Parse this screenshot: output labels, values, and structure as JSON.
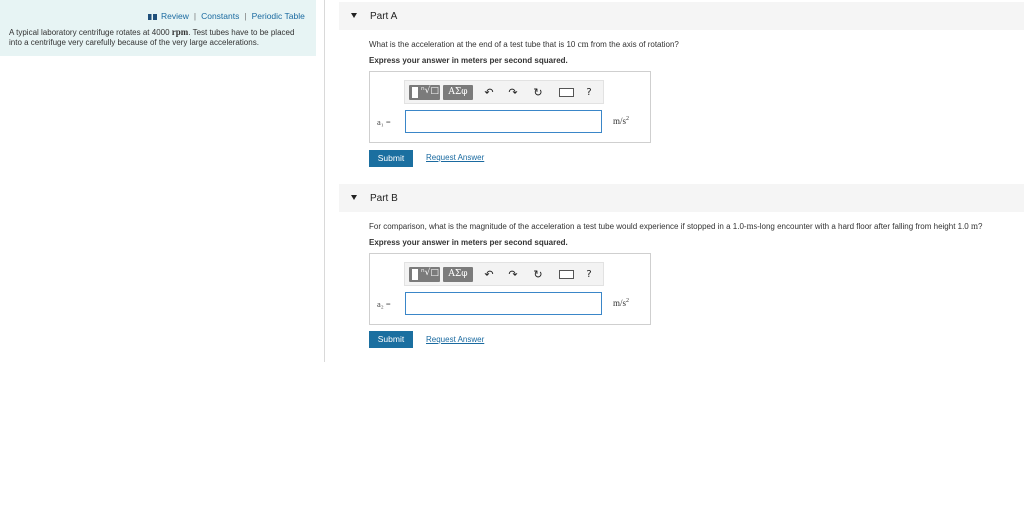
{
  "sidebar": {
    "links": {
      "review": "Review",
      "constants": "Constants",
      "periodic_table": "Periodic Table",
      "separator": "|"
    },
    "intro": {
      "text1": "A typical laboratory centrifuge rotates at 4000 ",
      "unit": "rpm",
      "text2": ". Test tubes have to be placed into a centrifuge very carefully because of the very large accelerations."
    }
  },
  "parts": [
    {
      "title": "Part A",
      "question": {
        "text1": "What is the acceleration at the end of a test tube that is 10 ",
        "unit": "cm",
        "text2": " from the axis of rotation?"
      },
      "instruction": "Express your answer in meters per second squared.",
      "variable_label": "a₁ =",
      "input_value": "",
      "unit_base": "m/s",
      "unit_exp": "2",
      "submit_label": "Submit",
      "request_label": "Request Answer"
    },
    {
      "title": "Part B",
      "question": {
        "text1": "For comparison, what is the magnitude of the acceleration a test tube would experience if stopped in a 1.0-",
        "unit1": "ms",
        "text2": "-long encounter with a hard floor after falling from height 1.0 ",
        "unit2": "m",
        "text3": "?"
      },
      "instruction": "Express your answer in meters per second squared.",
      "variable_label": "a₂ =",
      "input_value": "",
      "unit_base": "m/s",
      "unit_exp": "2",
      "submit_label": "Submit",
      "request_label": "Request Answer"
    }
  ],
  "toolbar": {
    "fraction_glyph": "ⁿ√□",
    "greek_glyph": "AΣφ",
    "undo_glyph": "↶",
    "redo_glyph": "↷",
    "reset_glyph": "↻",
    "help_glyph": "?",
    "icons": [
      "templates-icon",
      "greek-symbols-icon",
      "undo-icon",
      "redo-icon",
      "reset-icon",
      "keyboard-icon",
      "help-icon"
    ]
  }
}
